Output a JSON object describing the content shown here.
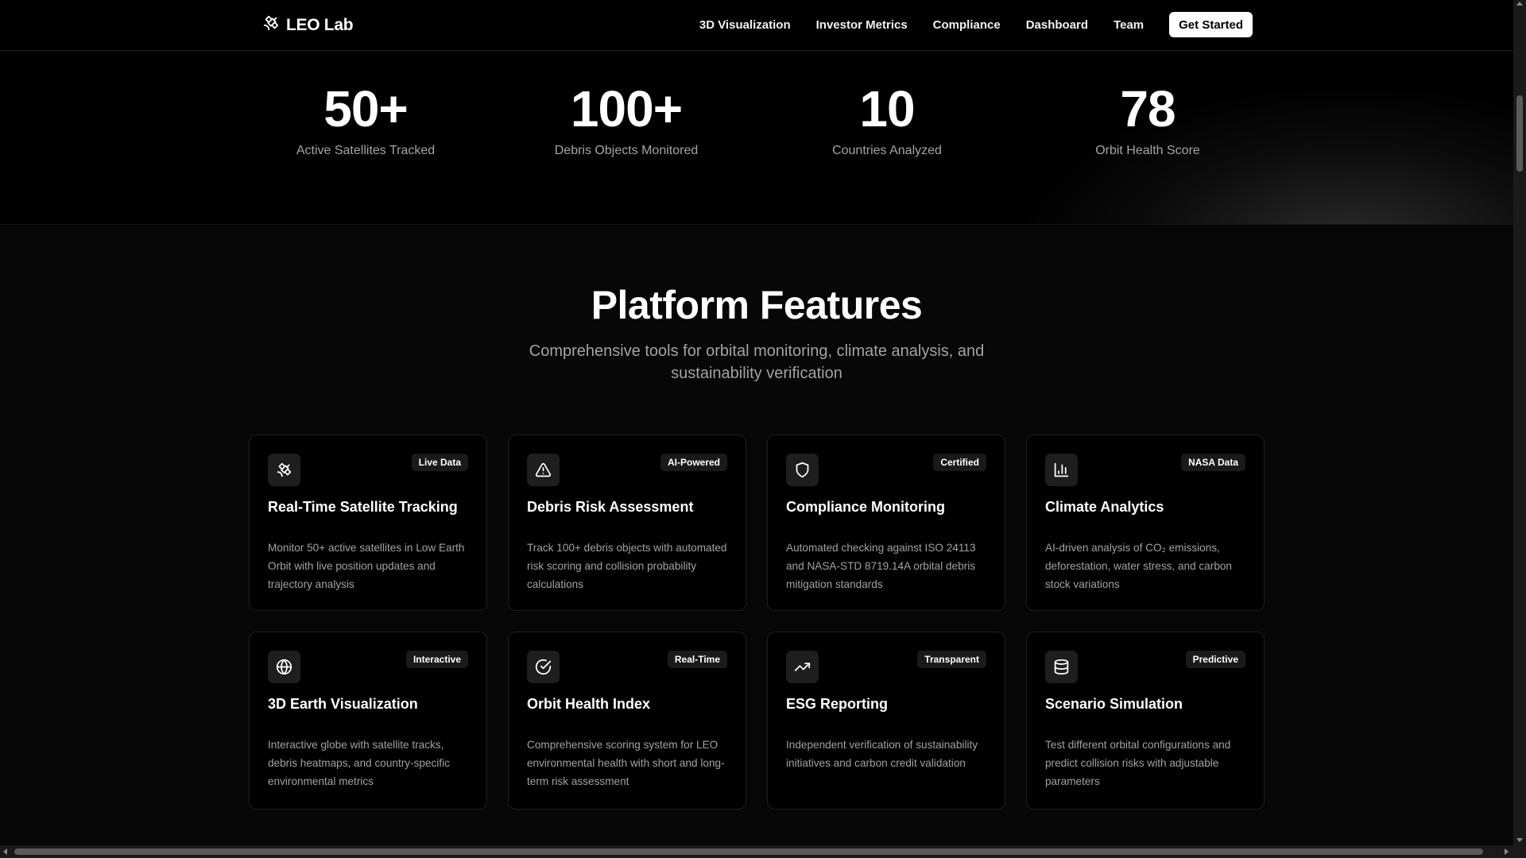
{
  "nav": {
    "brand": "LEO Lab",
    "brand_icon": "satellite-icon",
    "links": [
      "3D Visualization",
      "Investor Metrics",
      "Compliance",
      "Dashboard",
      "Team"
    ],
    "cta": "Get Started"
  },
  "stats": [
    {
      "value": "50+",
      "label": "Active Satellites Tracked"
    },
    {
      "value": "100+",
      "label": "Debris Objects Monitored"
    },
    {
      "value": "10",
      "label": "Countries Analyzed"
    },
    {
      "value": "78",
      "label": "Orbit Health Score"
    }
  ],
  "features": {
    "title": "Platform Features",
    "subtitle": "Comprehensive tools for orbital monitoring, climate analysis, and sustainability verification",
    "cards": [
      {
        "icon": "satellite-icon",
        "badge": "Live Data",
        "title": "Real-Time Satellite Tracking",
        "description": "Monitor 50+ active satellites in Low Earth Orbit with live position updates and trajectory analysis"
      },
      {
        "icon": "warning-triangle-icon",
        "badge": "AI-Powered",
        "title": "Debris Risk Assessment",
        "description": "Track 100+ debris objects with automated risk scoring and collision probability calculations"
      },
      {
        "icon": "shield-icon",
        "badge": "Certified",
        "title": "Compliance Monitoring",
        "description": "Automated checking against ISO 24113 and NASA-STD 8719.14A orbital debris mitigation standards"
      },
      {
        "icon": "bar-chart-icon",
        "badge": "NASA Data",
        "title": "Climate Analytics",
        "description": "AI-driven analysis of CO₂ emissions, deforestation, water stress, and carbon stock variations"
      },
      {
        "icon": "globe-icon",
        "badge": "Interactive",
        "title": "3D Earth Visualization",
        "description": "Interactive globe with satellite tracks, debris heatmaps, and country-specific environmental metrics"
      },
      {
        "icon": "check-circle-icon",
        "badge": "Real-Time",
        "title": "Orbit Health Index",
        "description": "Comprehensive scoring system for LEO environmental health with short and long-term risk assessment"
      },
      {
        "icon": "trending-up-icon",
        "badge": "Transparent",
        "title": "ESG Reporting",
        "description": "Independent verification of sustainability initiatives and carbon credit validation"
      },
      {
        "icon": "database-icon",
        "badge": "Predictive",
        "title": "Scenario Simulation",
        "description": "Test different orbital configurations and predict collision risks with adjustable parameters"
      }
    ]
  }
}
